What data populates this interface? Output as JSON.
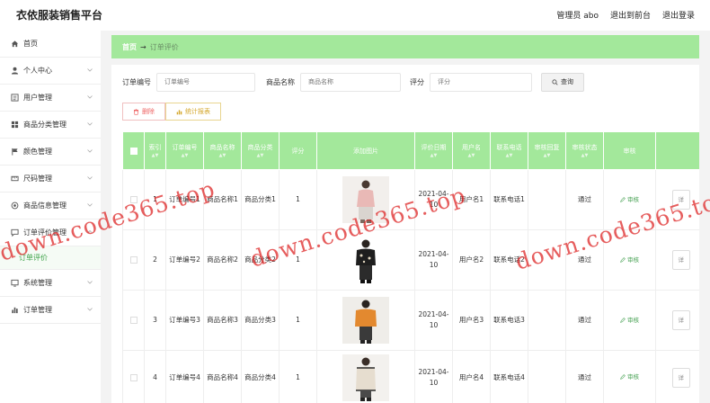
{
  "header": {
    "title": "衣依服装销售平台",
    "user": "管理员 abo",
    "front_link": "退出到前台",
    "logout": "退出登录"
  },
  "sidebar": {
    "items": [
      {
        "label": "首页",
        "icon": "home-icon"
      },
      {
        "label": "个人中心",
        "icon": "user-icon"
      },
      {
        "label": "用户管理",
        "icon": "list-icon"
      },
      {
        "label": "商品分类管理",
        "icon": "grid-icon"
      },
      {
        "label": "颜色管理",
        "icon": "flag-icon"
      },
      {
        "label": "尺码管理",
        "icon": "ruler-icon"
      },
      {
        "label": "商品信息管理",
        "icon": "cog-circle-icon"
      },
      {
        "label": "订单评价管理",
        "icon": "chat-icon"
      },
      {
        "label": "系统管理",
        "icon": "monitor-icon"
      },
      {
        "label": "订单管理",
        "icon": "bar-chart-icon"
      }
    ],
    "sub_item": "订单评价"
  },
  "breadcrumb": {
    "home": "首页",
    "current": "订单评价"
  },
  "search": {
    "order_no_label": "订单编号",
    "order_no_placeholder": "订单编号",
    "product_label": "商品名称",
    "product_placeholder": "商品名称",
    "rating_label": "评分",
    "rating_placeholder": "评分",
    "query_button": "查询"
  },
  "actions": {
    "delete": "删除",
    "report": "统计报表"
  },
  "table": {
    "headers": [
      "索引",
      "订单编号",
      "商品名称",
      "商品分类",
      "评分",
      "添加图片",
      "评价日期",
      "用户名",
      "联系电话",
      "审核回复",
      "审核状态",
      "审核"
    ],
    "sort_hint": "▲▼",
    "audit_label": "审核",
    "side_button": "详",
    "rows": [
      {
        "index": "1",
        "order_no": "订单编号1",
        "product": "商品名称1",
        "category": "商品分类1",
        "rating": "1",
        "date": "2021-04-10",
        "user": "用户名1",
        "phone": "联系电话1",
        "reply": "",
        "status": "通过"
      },
      {
        "index": "2",
        "order_no": "订单编号2",
        "product": "商品名称2",
        "category": "商品分类2",
        "rating": "1",
        "date": "2021-04-10",
        "user": "用户名2",
        "phone": "联系电话2",
        "reply": "",
        "status": "通过"
      },
      {
        "index": "3",
        "order_no": "订单编号3",
        "product": "商品名称3",
        "category": "商品分类3",
        "rating": "1",
        "date": "2021-04-10",
        "user": "用户名3",
        "phone": "联系电话3",
        "reply": "",
        "status": "通过"
      },
      {
        "index": "4",
        "order_no": "订单编号4",
        "product": "商品名称4",
        "category": "商品分类4",
        "rating": "1",
        "date": "2021-04-10",
        "user": "用户名4",
        "phone": "联系电话4",
        "reply": "",
        "status": "通过"
      }
    ]
  },
  "watermark": "down.code365.top",
  "colors": {
    "accent_green": "#a3e89b",
    "link_green": "#4ba357",
    "watermark_red": "#dc1e1e"
  }
}
